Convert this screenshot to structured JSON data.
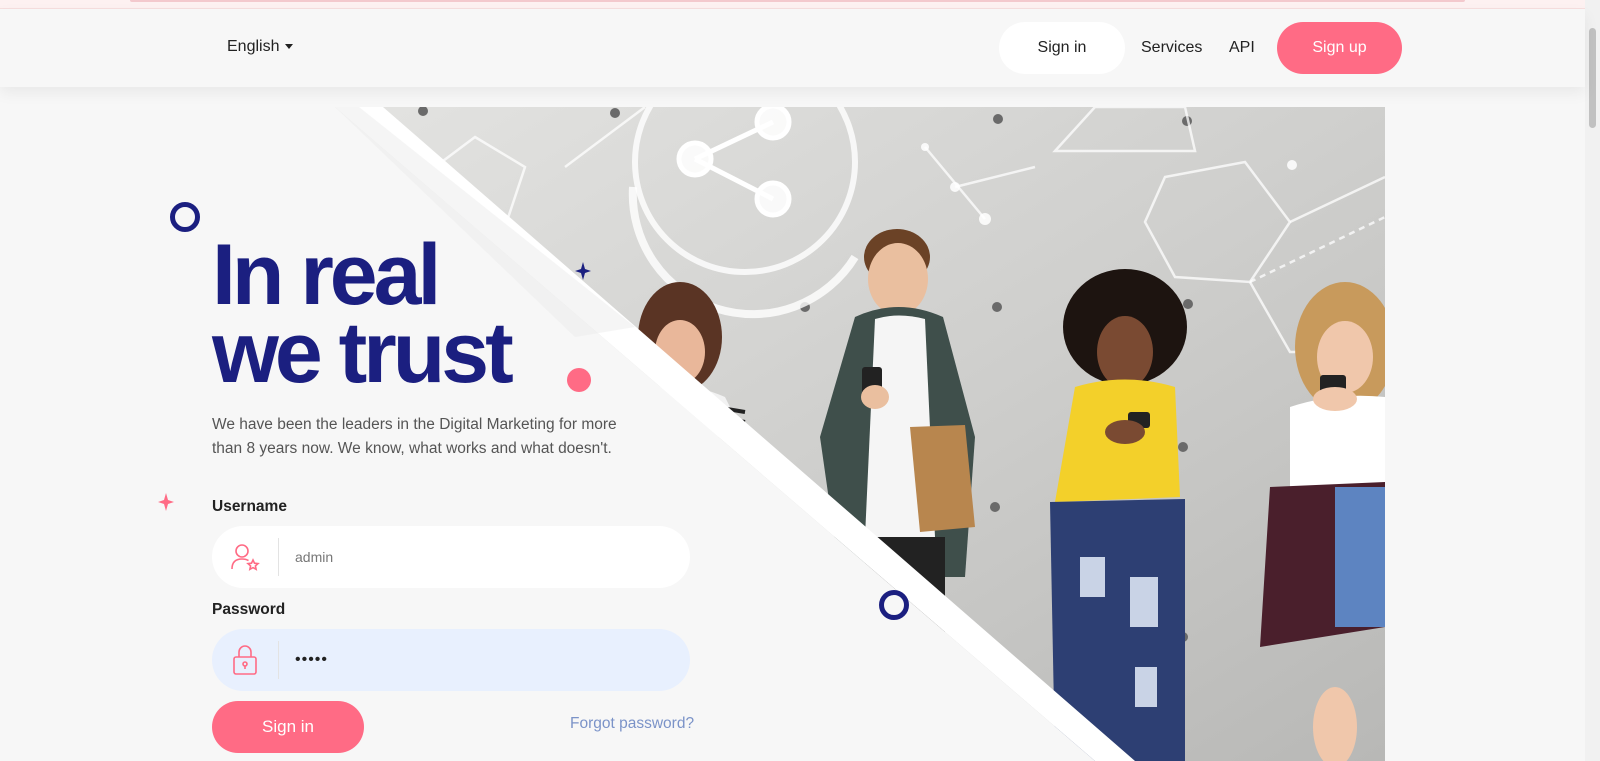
{
  "nav": {
    "language": "English",
    "signin": "Sign in",
    "services": "Services",
    "api": "API",
    "signup": "Sign up"
  },
  "hero": {
    "headline_line1": "In real",
    "headline_line2": "we trust",
    "description": "We have been the leaders in the Digital Marketing for more than 8 years now. We know, what works and what doesn't."
  },
  "form": {
    "username_label": "Username",
    "username_value": "admin",
    "password_label": "Password",
    "password_value": "•••••",
    "signin_button": "Sign in",
    "forgot_link": "Forgot password?"
  },
  "colors": {
    "accent": "#ff6b85",
    "brand": "#1b1f80",
    "background": "#f7f7f7",
    "password_field_bg": "#e8f0fe"
  },
  "icons": [
    "user-icon",
    "lock-icon",
    "share-icon",
    "chevron-down-icon"
  ]
}
